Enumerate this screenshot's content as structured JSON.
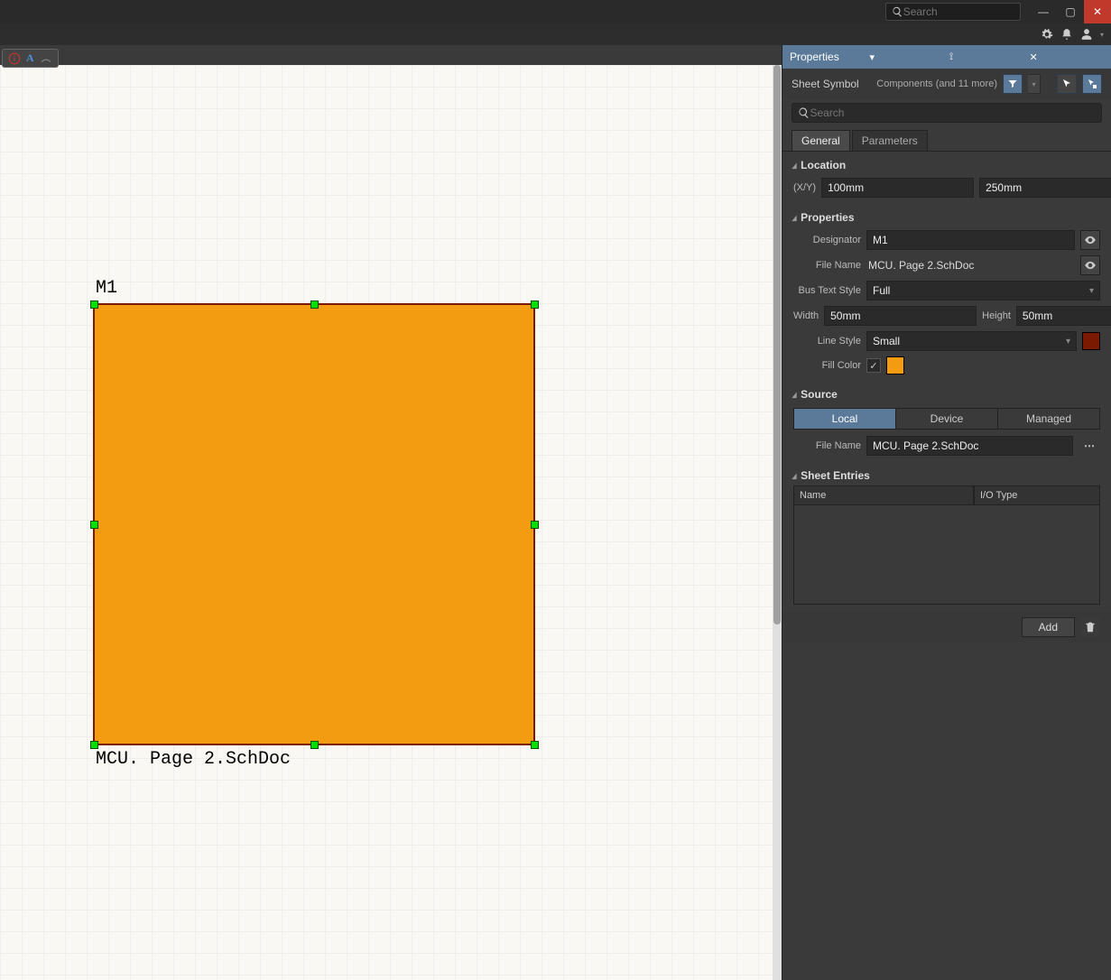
{
  "titlebar": {
    "search_placeholder": "Search"
  },
  "panel": {
    "title": "Properties",
    "crumb": "Sheet Symbol",
    "filter_summary": "Components (and 11 more)",
    "search_placeholder": "Search",
    "tabs": {
      "general": "General",
      "parameters": "Parameters"
    },
    "sections": {
      "location": {
        "title": "Location",
        "xy_label": "(X/Y)",
        "x": "100mm",
        "y": "250mm"
      },
      "properties": {
        "title": "Properties",
        "designator_label": "Designator",
        "designator": "M1",
        "filename_label": "File Name",
        "filename": "MCU. Page 2.SchDoc",
        "bus_label": "Bus Text Style",
        "bus_value": "Full",
        "width_label": "Width",
        "width": "50mm",
        "height_label": "Height",
        "height": "50mm",
        "linestyle_label": "Line Style",
        "linestyle": "Small",
        "line_color": "#7a1a00",
        "fill_label": "Fill Color",
        "fill_color": "#f39c12"
      },
      "source": {
        "title": "Source",
        "segments": {
          "local": "Local",
          "device": "Device",
          "managed": "Managed"
        },
        "filename_label": "File Name",
        "filename": "MCU. Page 2.SchDoc"
      },
      "sheet_entries": {
        "title": "Sheet Entries",
        "col_name": "Name",
        "col_io": "I/O Type",
        "add_label": "Add"
      }
    }
  },
  "canvas": {
    "designator_label": "M1",
    "filename_label": "MCU. Page 2.SchDoc",
    "tool_chip": {
      "a": "A"
    }
  }
}
